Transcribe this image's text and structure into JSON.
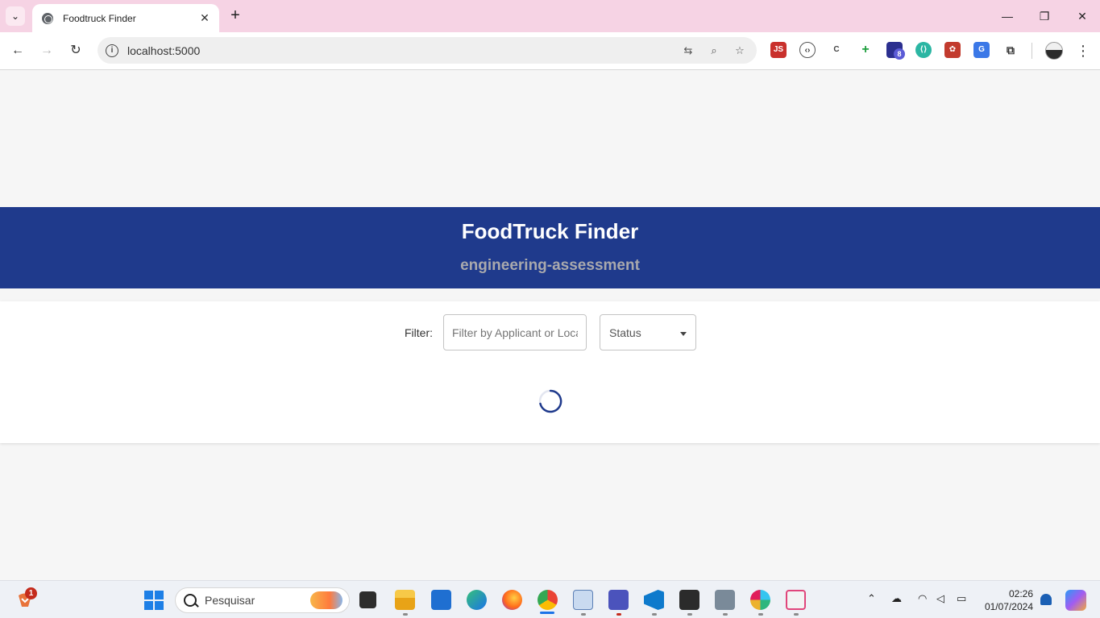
{
  "browser": {
    "tab_title": "Foodtruck Finder",
    "url": "localhost:5000",
    "extensions_badge": "8"
  },
  "page": {
    "title": "FoodTruck Finder",
    "subtitle": "engineering-assessment",
    "filter_label": "Filter:",
    "search_placeholder": "Filter by Applicant or Location",
    "search_value": "",
    "status_label": "Status",
    "loading": true
  },
  "taskbar": {
    "search_label": "Pesquisar",
    "weather_badge": "1",
    "time": "02:26",
    "date": "01/07/2024",
    "apps": [
      "file-explorer",
      "microsoft-store",
      "edge",
      "firefox",
      "chrome",
      "activity-monitor",
      "teams",
      "vscode",
      "terminal",
      "file-cabinet",
      "slack",
      "snipping-tool"
    ]
  },
  "colors": {
    "tabstrip": "#f6d3e4",
    "header_bg": "#1f3a8c",
    "header_title": "#ffffff",
    "header_subtitle": "#a9a9ad",
    "spinner": "#1f3a8c"
  }
}
